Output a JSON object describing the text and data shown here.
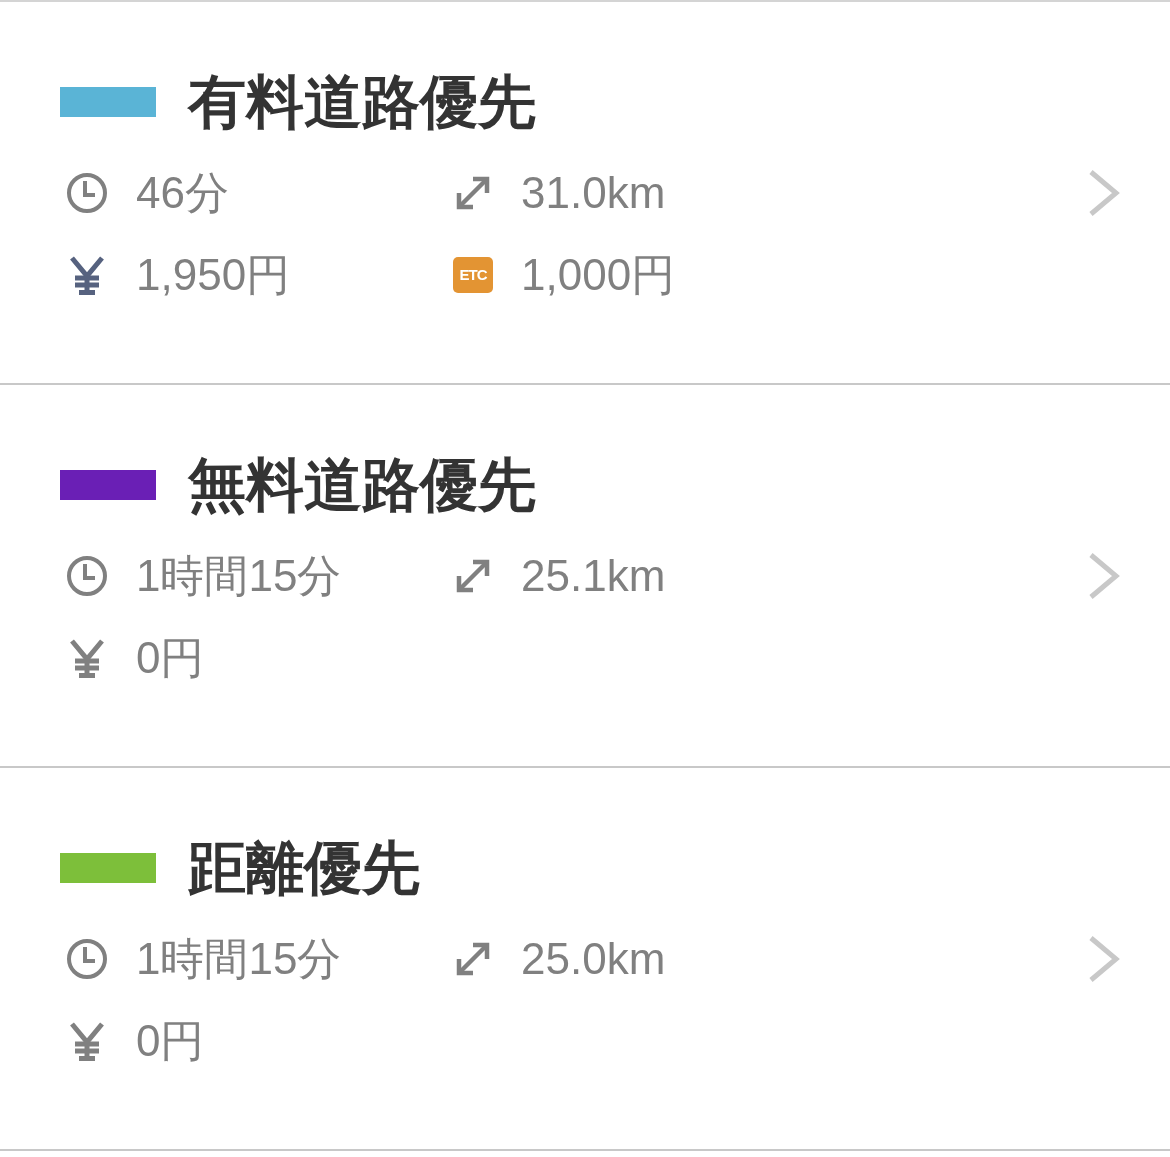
{
  "routes": [
    {
      "title": "有料道路優先",
      "color": "#5ab4d6",
      "time": "46分",
      "distance": "31.0km",
      "fare": {
        "amount": "1,950円",
        "toll": true
      },
      "etc": {
        "badge": "ETC",
        "amount": "1,000円"
      }
    },
    {
      "title": "無料道路優先",
      "color": "#6a1fb5",
      "time": "1時間15分",
      "distance": "25.1km",
      "fare": {
        "amount": "0円",
        "toll": false
      }
    },
    {
      "title": "距離優先",
      "color": "#7dbf3a",
      "time": "1時間15分",
      "distance": "25.0km",
      "fare": {
        "amount": "0円",
        "toll": false
      }
    }
  ]
}
